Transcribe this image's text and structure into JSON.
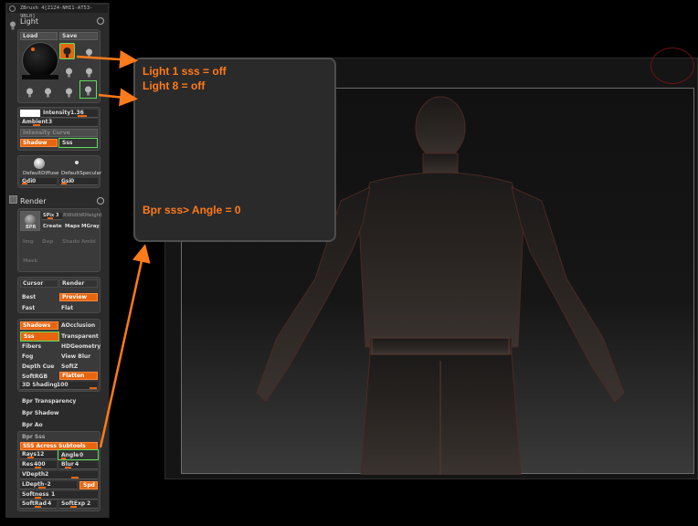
{
  "app": {
    "title": "ZBrush 4[Z1Z4-NHI1-AT53-9BL0]"
  },
  "light": {
    "title": "Light",
    "load_label": "Load",
    "save_label": "Save",
    "intensity_label": "Intensity",
    "intensity_value": "1.36",
    "ambient_label": "Ambient",
    "ambient_value": "3",
    "intensity_curve_label": "Intensity Curve",
    "shadow_label": "Shadow",
    "sss_label": "Sss",
    "default_diffuse_label": "DefaultDiffuse",
    "default_specular_label": "DefaultSpecular",
    "gdi_label": "Gdi",
    "gdi_value": "0",
    "gsi_label": "Gsi",
    "gsi_value": "0"
  },
  "render": {
    "title": "Render",
    "bpr_label": "BPR",
    "spix_label": "SPix",
    "spix_value": "3",
    "rwidth_label": "RWidth",
    "rheight_label": "RHeight",
    "create_label": "Create",
    "maps_label": "Maps",
    "mgray_label": "MGray",
    "img_label": "Img",
    "dep_label": "Dep",
    "shado_label": "Shado",
    "ambi_label": "Ambi",
    "mask_label": "Mask",
    "cursor_label": "Cursor",
    "render_label": "Render",
    "best_label": "Best",
    "preview_label": "Preview",
    "fast_label": "Fast",
    "flat_label": "Flat",
    "shadows_label": "Shadows",
    "aocclusion_label": "AOcclusion",
    "sss_label": "Sss",
    "transparent_label": "Transparent",
    "fibers_label": "Fibers",
    "hdgeometry_label": "HDGeometry",
    "fog_label": "Fog",
    "viewblur_label": "View Blur",
    "depthcue_label": "Depth Cue",
    "softz_label": "SoftZ",
    "softrgb_label": "SoftRGB",
    "flatten_label": "Flatten",
    "shading3d_label": "3D Shading",
    "shading3d_value": "100",
    "bpr_transparency_label": "Bpr Transparency",
    "bpr_shadow_label": "Bpr Shadow",
    "bpr_ao_label": "Bpr Ao",
    "bpr_sss_label": "Bpr Sss",
    "sss_across_label": "SSS Across Subtools",
    "rays_label": "Rays",
    "rays_value": "12",
    "angle_label": "Angle",
    "angle_value": "0",
    "res_label": "Res",
    "res_value": "400",
    "blur_label": "Blur",
    "blur_value": "4",
    "vdepth_label": "VDepth",
    "vdepth_value": "2",
    "ldepth_label": "LDepth",
    "ldepth_value": "-2",
    "spd_label": "Spd",
    "softness_label": "Softness",
    "softness_value": "1",
    "softrad_label": "SoftRad",
    "softrad_value": "4",
    "softexp_label": "SoftExp",
    "softexp_value": "2"
  },
  "note": {
    "line1": "Light 1 sss = off",
    "line2": "Light 8 = off",
    "line3": "Bpr sss> Angle = 0"
  },
  "colors": {
    "accent": "#e8650f",
    "annotation": "#ff7a1a",
    "highlight": "#5be05b"
  }
}
